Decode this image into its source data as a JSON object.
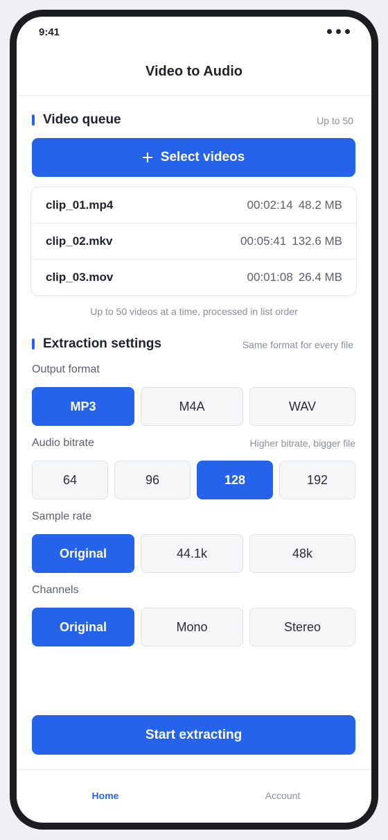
{
  "status_bar": {
    "time": "9:41"
  },
  "header": {
    "title": "Video to Audio"
  },
  "queue": {
    "title": "Video queue",
    "limit_label": "Up to 50",
    "select_label": "Select videos",
    "files": [
      {
        "name": "clip_01.mp4",
        "duration": "00:02:14",
        "size": "48.2 MB"
      },
      {
        "name": "clip_02.mkv",
        "duration": "00:05:41",
        "size": "132.6 MB"
      },
      {
        "name": "clip_03.mov",
        "duration": "00:01:08",
        "size": "26.4 MB"
      }
    ],
    "note": "Up to 50 videos at a time, processed in list order"
  },
  "settings": {
    "title": "Extraction settings",
    "subtitle": "Same format for every file",
    "output_format": {
      "label": "Output format",
      "options": [
        "MP3",
        "M4A",
        "WAV"
      ],
      "selected": "MP3"
    },
    "audio_bitrate": {
      "label": "Audio bitrate",
      "hint": "Higher bitrate, bigger file",
      "options": [
        "64",
        "96",
        "128",
        "192"
      ],
      "selected": "128"
    },
    "sample_rate": {
      "label": "Sample rate",
      "options": [
        "Original",
        "44.1k",
        "48k"
      ],
      "selected": "Original"
    },
    "channels": {
      "label": "Channels",
      "options": [
        "Original",
        "Mono",
        "Stereo"
      ],
      "selected": "Original"
    }
  },
  "start_button": {
    "label": "Start extracting"
  },
  "tab_bar": {
    "tabs": [
      {
        "label": "Home",
        "active": true
      },
      {
        "label": "Account",
        "active": false
      }
    ]
  },
  "colors": {
    "accent": "#2563eb",
    "text": "#1f2329",
    "muted": "#8b8f97",
    "option_bg": "#f5f6f8"
  }
}
